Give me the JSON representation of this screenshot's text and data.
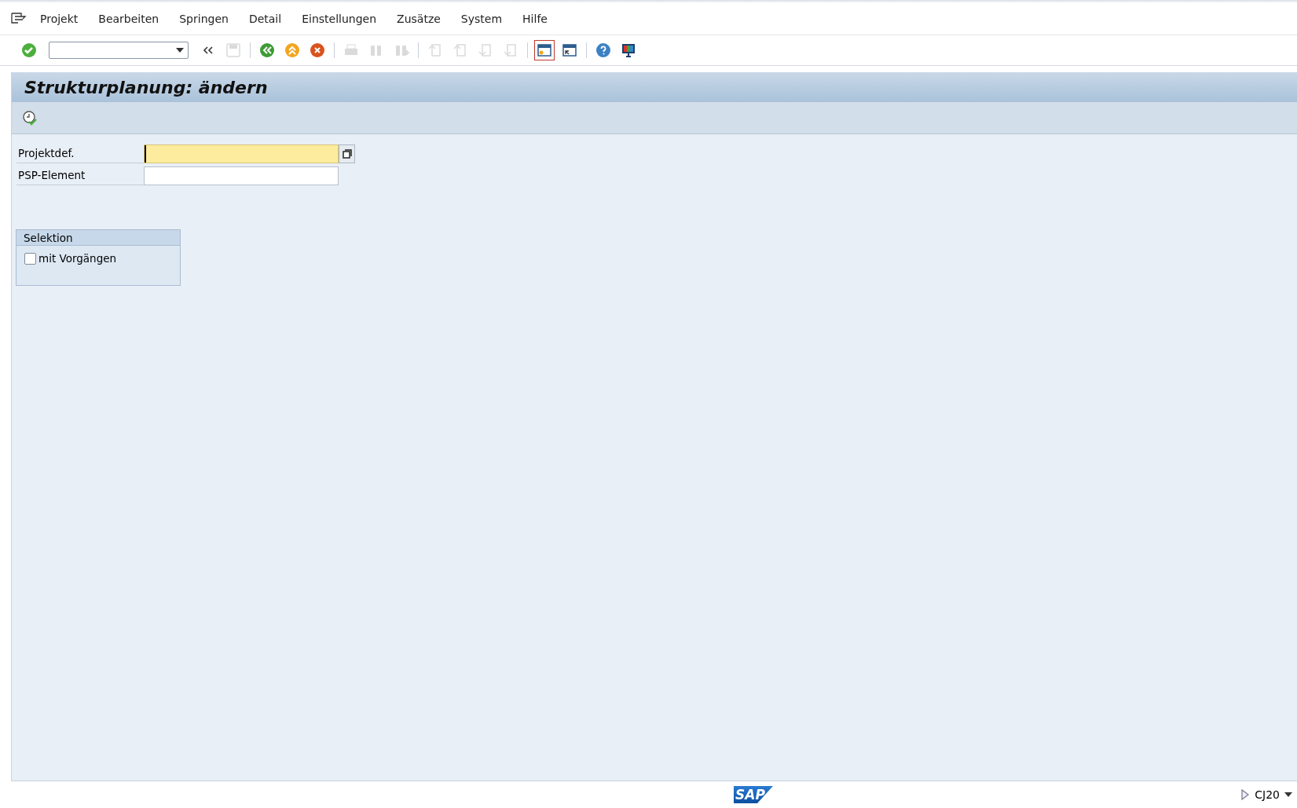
{
  "menu": [
    {
      "label": "Projekt"
    },
    {
      "label": "Bearbeiten"
    },
    {
      "label": "Springen"
    },
    {
      "label": "Detail"
    },
    {
      "label": "Einstellungen"
    },
    {
      "label": "Zusätze"
    },
    {
      "label": "System"
    },
    {
      "label": "Hilfe"
    }
  ],
  "toolbar": [
    {
      "kind": "enter",
      "disabled": false
    },
    {
      "kind": "command"
    },
    {
      "kind": "collapse",
      "disabled": false
    },
    {
      "kind": "save",
      "disabled": true
    },
    {
      "kind": "sep"
    },
    {
      "kind": "back",
      "disabled": false
    },
    {
      "kind": "exit",
      "disabled": false
    },
    {
      "kind": "cancel",
      "disabled": false
    },
    {
      "kind": "sep"
    },
    {
      "kind": "print",
      "disabled": true
    },
    {
      "kind": "find",
      "disabled": true
    },
    {
      "kind": "findnext",
      "disabled": true
    },
    {
      "kind": "sep"
    },
    {
      "kind": "first",
      "disabled": true
    },
    {
      "kind": "prev",
      "disabled": true
    },
    {
      "kind": "next",
      "disabled": true
    },
    {
      "kind": "last",
      "disabled": true
    },
    {
      "kind": "sep"
    },
    {
      "kind": "newsession",
      "disabled": false,
      "selected": true
    },
    {
      "kind": "shortcut",
      "disabled": false
    },
    {
      "kind": "sep"
    },
    {
      "kind": "help",
      "disabled": false
    },
    {
      "kind": "layout",
      "disabled": false
    }
  ],
  "title": "Strukturplanung: ändern",
  "app_toolbar": [
    {
      "kind": "clock-check"
    }
  ],
  "fields": [
    {
      "label": "Projektdef.",
      "required": true,
      "focused": true,
      "f4": true
    },
    {
      "label": "PSP-Element",
      "required": false,
      "focused": false
    }
  ],
  "selection": {
    "title": "Selektion",
    "options": [
      {
        "label": "mit Vorgängen",
        "checked": false
      }
    ]
  },
  "status_bar": {
    "logo": "SAP",
    "transaction": "CJ20"
  }
}
